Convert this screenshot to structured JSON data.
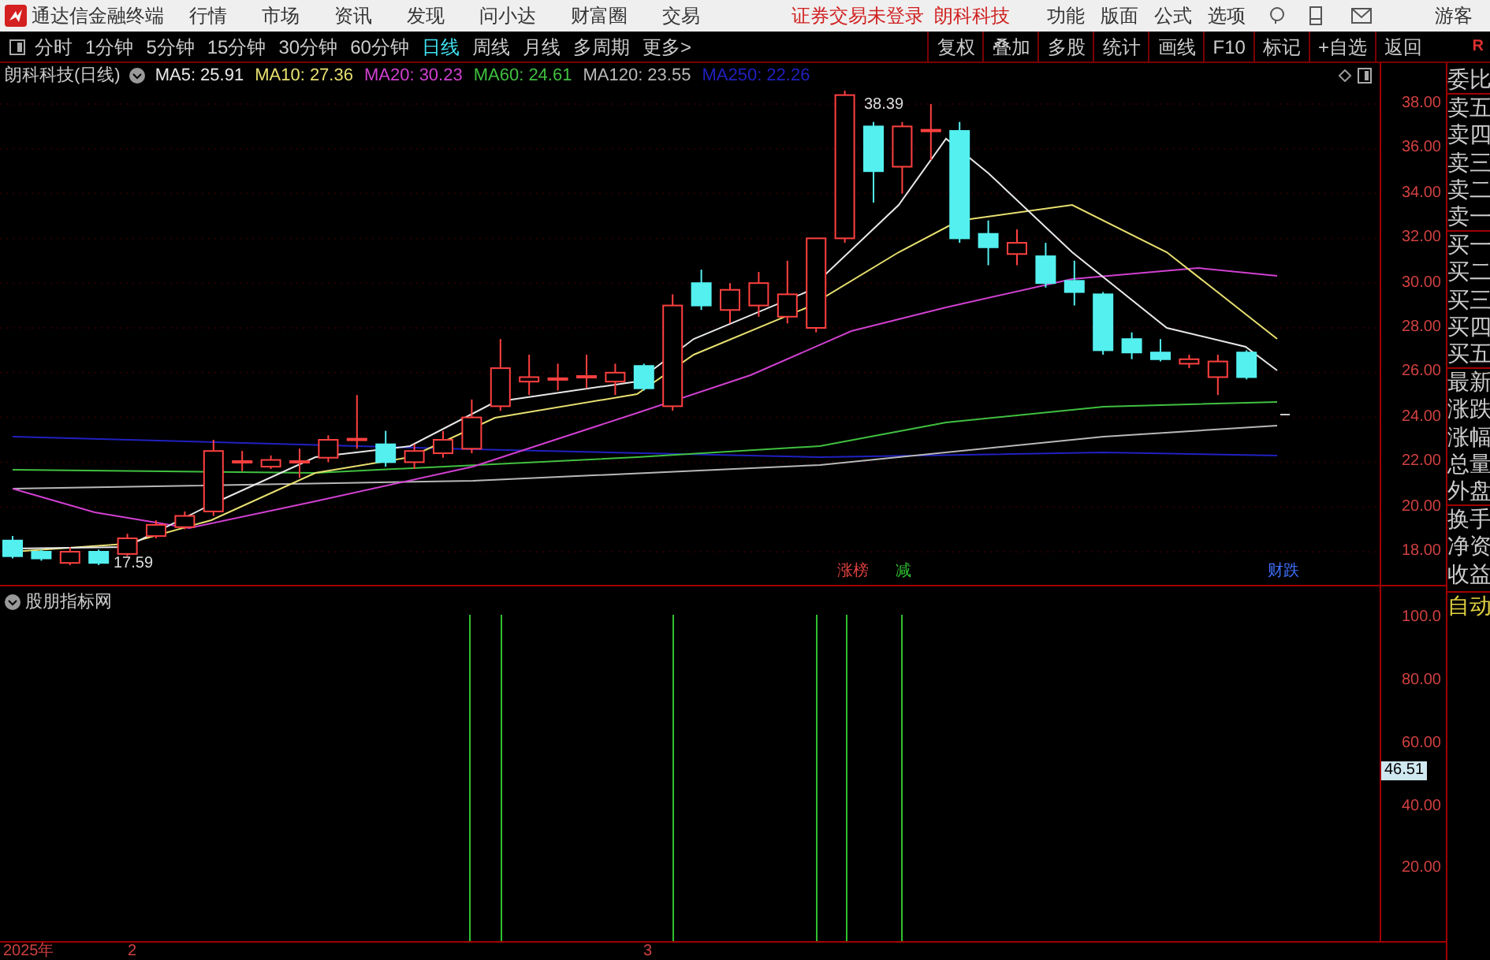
{
  "app": {
    "title": "通达信金融终端",
    "menu": [
      "行情",
      "市场",
      "资讯",
      "发现",
      "问小达",
      "财富圈",
      "交易"
    ],
    "notice": "证券交易未登录  朗科科技",
    "tools": [
      "功能",
      "版面",
      "公式",
      "选项"
    ],
    "user": "游客"
  },
  "periods": [
    {
      "label": "分时",
      "selected": false
    },
    {
      "label": "1分钟",
      "selected": false
    },
    {
      "label": "5分钟",
      "selected": false
    },
    {
      "label": "15分钟",
      "selected": false
    },
    {
      "label": "30分钟",
      "selected": false
    },
    {
      "label": "60分钟",
      "selected": false
    },
    {
      "label": "日线",
      "selected": true
    },
    {
      "label": "周线",
      "selected": false
    },
    {
      "label": "月线",
      "selected": false
    },
    {
      "label": "多周期",
      "selected": false
    },
    {
      "label": "更多>",
      "selected": false
    }
  ],
  "actions": [
    "复权",
    "叠加",
    "多股",
    "统计",
    "画线",
    "F10",
    "标记",
    "+自选",
    "返回"
  ],
  "corner": "R",
  "chart": {
    "title": "朗科科技(日线)",
    "legend": [
      {
        "label": "MA5: 25.91",
        "color": "#e8e8e8"
      },
      {
        "label": "MA10: 27.36",
        "color": "#e8e070"
      },
      {
        "label": "MA20: 30.23",
        "color": "#d040d0"
      },
      {
        "label": "MA60: 24.61",
        "color": "#40c040"
      },
      {
        "label": "MA120: 23.55",
        "color": "#b8b8b8"
      },
      {
        "label": "MA250: 22.26",
        "color": "#2020c0"
      }
    ],
    "high_label": "38.39",
    "low_label": "17.59",
    "price_ticks": [
      "38.00",
      "36.00",
      "34.00",
      "32.00",
      "30.00",
      "28.00",
      "26.00",
      "24.00",
      "22.00",
      "20.00",
      "18.00"
    ],
    "events": [
      {
        "label": "涨榜",
        "color": "#e04040"
      },
      {
        "label": "减",
        "color": "#30c030"
      },
      {
        "label": "财跌",
        "color": "#4070ff"
      }
    ]
  },
  "indicator": {
    "title": "股朋指标网",
    "ticks": [
      "100.0",
      "80.00",
      "60.00",
      "40.00",
      "20.00"
    ],
    "current": "46.51"
  },
  "time_axis": [
    "2025年",
    "2",
    "3"
  ],
  "sidebar": {
    "items": [
      "委比",
      "卖五",
      "卖四",
      "卖三",
      "卖二",
      "卖一",
      "买一",
      "买二",
      "买三",
      "买四",
      "买五",
      "最新",
      "涨跌",
      "涨幅",
      "总量",
      "外盘",
      "换手",
      "净资",
      "收益"
    ],
    "mode": "自动"
  }
}
